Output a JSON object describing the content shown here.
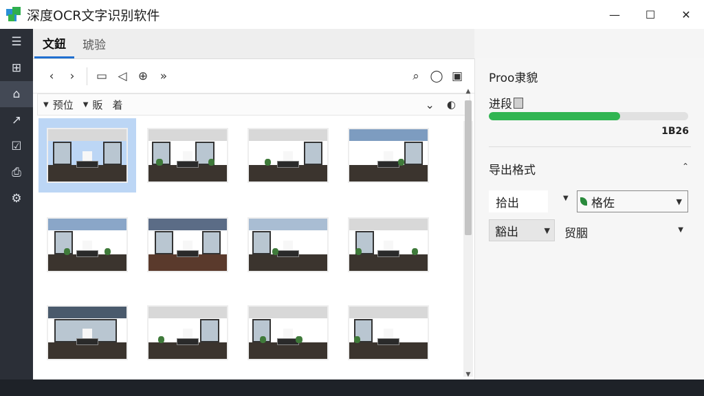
{
  "window": {
    "title": "深度OCR文字识别软件",
    "controls": {
      "minimize": "—",
      "maximize": "☐",
      "close": "✕"
    }
  },
  "sidebar": {
    "items": [
      {
        "icon": "list-icon",
        "glyph": "☰"
      },
      {
        "icon": "layout-icon",
        "glyph": "⊞"
      },
      {
        "icon": "tag-icon",
        "glyph": "⌂"
      },
      {
        "icon": "chart-icon",
        "glyph": "↗"
      },
      {
        "icon": "check-icon",
        "glyph": "☑"
      },
      {
        "icon": "document-icon",
        "glyph": "⎙"
      },
      {
        "icon": "gear-icon",
        "glyph": "⚙"
      }
    ],
    "active_index": 2
  },
  "tabs": [
    {
      "label": "文鈕"
    },
    {
      "label": "琥验"
    }
  ],
  "toolbar": {
    "glyphs": {
      "back": "‹",
      "forward": "›",
      "folder": "▭",
      "share": "◁",
      "crosshair": "⊕",
      "forward_double": "»",
      "search": "⌕",
      "user": "◯",
      "camera": "▣"
    }
  },
  "filter": {
    "item1": "预位",
    "item2": "販",
    "item3": "着",
    "chevron": "⌄",
    "sound": "◐"
  },
  "right_panel": {
    "title": "Proo隶貌",
    "progress_label": "进段",
    "progress_percent": 66,
    "progress_value": "1B26",
    "section_title": "导出格式",
    "section_chevron": "⌃",
    "field1_label": "拾出",
    "select1_value": "格佐",
    "select2_value": "豁出",
    "budget_label": "贸胭"
  }
}
